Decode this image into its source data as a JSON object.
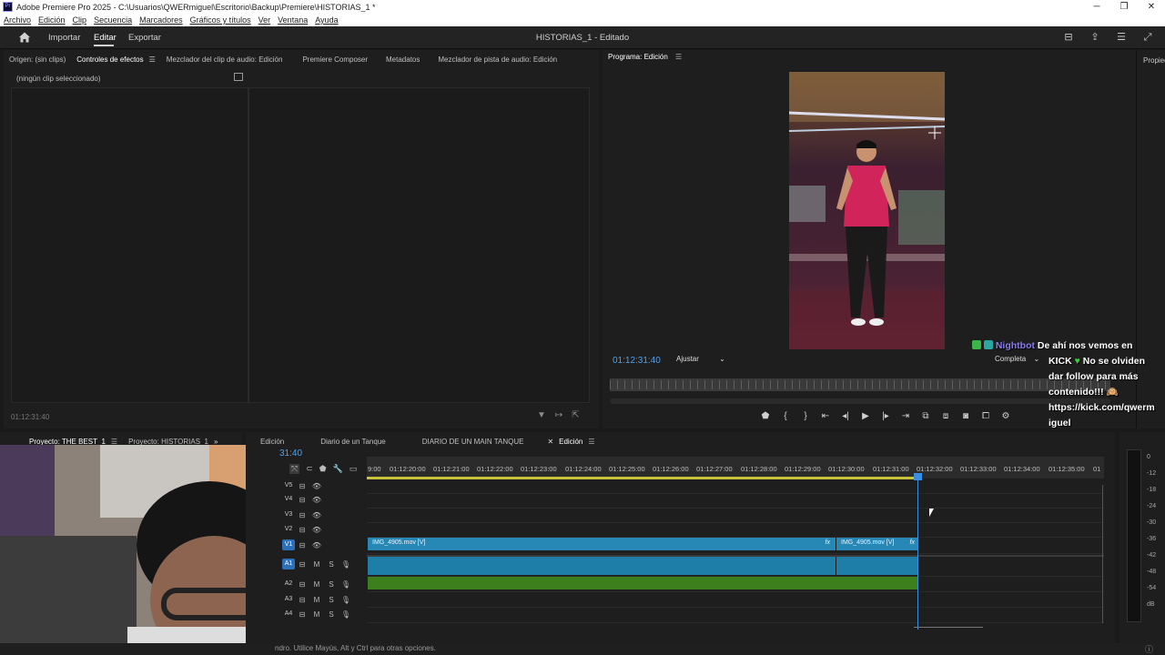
{
  "window": {
    "title": "Adobe Premiere Pro 2025 - C:\\Usuarios\\QWERmiguel\\Escritorio\\Backup\\Premiere\\HISTORIAS_1 *",
    "controls": [
      "─",
      "❐",
      "✕"
    ]
  },
  "menu": [
    "Archivo",
    "Edición",
    "Clip",
    "Secuencia",
    "Marcadores",
    "Gráficos y títulos",
    "Ver",
    "Ventana",
    "Ayuda"
  ],
  "header": {
    "tabs": [
      "Importar",
      "Editar",
      "Exportar"
    ],
    "active_tab": "Editar",
    "sequence_title": "HISTORIAS_1 - Editado"
  },
  "source_panel": {
    "tabs": [
      "Origen: (sin clips)",
      "Controles de efectos",
      "Mezclador del clip de audio: Edición",
      "Premiere Composer",
      "Metadatos",
      "Mezclador de pista de audio: Edición"
    ],
    "active_tab": "Controles de efectos",
    "no_clip": "(ningún clip seleccionado)",
    "timecode": "01:12:31:40"
  },
  "program_panel": {
    "title": "Programa: Edición",
    "timecode": "01:12:31:40",
    "fit": "Ajustar",
    "quality": "Completa"
  },
  "right_panel": {
    "label": "Propied"
  },
  "chat": {
    "user": "Nightbot",
    "message_1": "De ahí nos vemos en",
    "message_2": "KICK",
    "message_3": "No se olviden",
    "message_4": "dar follow para más",
    "message_5": "contenido!!!",
    "message_6": "https://kick.com/qwerm",
    "message_7": "iguel"
  },
  "project_panel": {
    "tabs": [
      "Proyecto: THE BEST_1",
      "Proyecto: HISTORIAS_1"
    ]
  },
  "timeline": {
    "tabs": [
      "Edición",
      "Diario de un Tanque",
      "DIARIO DE UN MAIN TANQUE",
      "Edición"
    ],
    "active_tab_index": 3,
    "timecode": "31:40",
    "ruler": [
      "9:00",
      "01:12:20:00",
      "01:12:21:00",
      "01:12:22:00",
      "01:12:23:00",
      "01:12:24:00",
      "01:12:25:00",
      "01:12:26:00",
      "01:12:27:00",
      "01:12:28:00",
      "01:12:29:00",
      "01:12:30:00",
      "01:12:31:00",
      "01:12:32:00",
      "01:12:33:00",
      "01:12:34:00",
      "01:12:35:00",
      "01"
    ],
    "video_tracks": [
      "V5",
      "V4",
      "V3",
      "V2",
      "V1"
    ],
    "audio_tracks": [
      "A1",
      "A2",
      "A3",
      "A4"
    ],
    "mute_label": "M",
    "solo_label": "S",
    "clip_1": "IMG_4905.mov [V]",
    "clip_2": "IMG_4905.mov [V]",
    "fx": "fx"
  },
  "meter": {
    "labels": [
      "0",
      "-12",
      "-18",
      "-24",
      "-30",
      "-36",
      "-42",
      "-48",
      "-54",
      "dB"
    ]
  },
  "status": "ndro. Utilice Mayús, Alt y Ctrl para otras opciones.",
  "colors": {
    "accent": "#4aa3f0",
    "clip_video": "#2787b5",
    "clip_audio": "#3d7f1c",
    "chat_user": "#8a7cf0"
  }
}
